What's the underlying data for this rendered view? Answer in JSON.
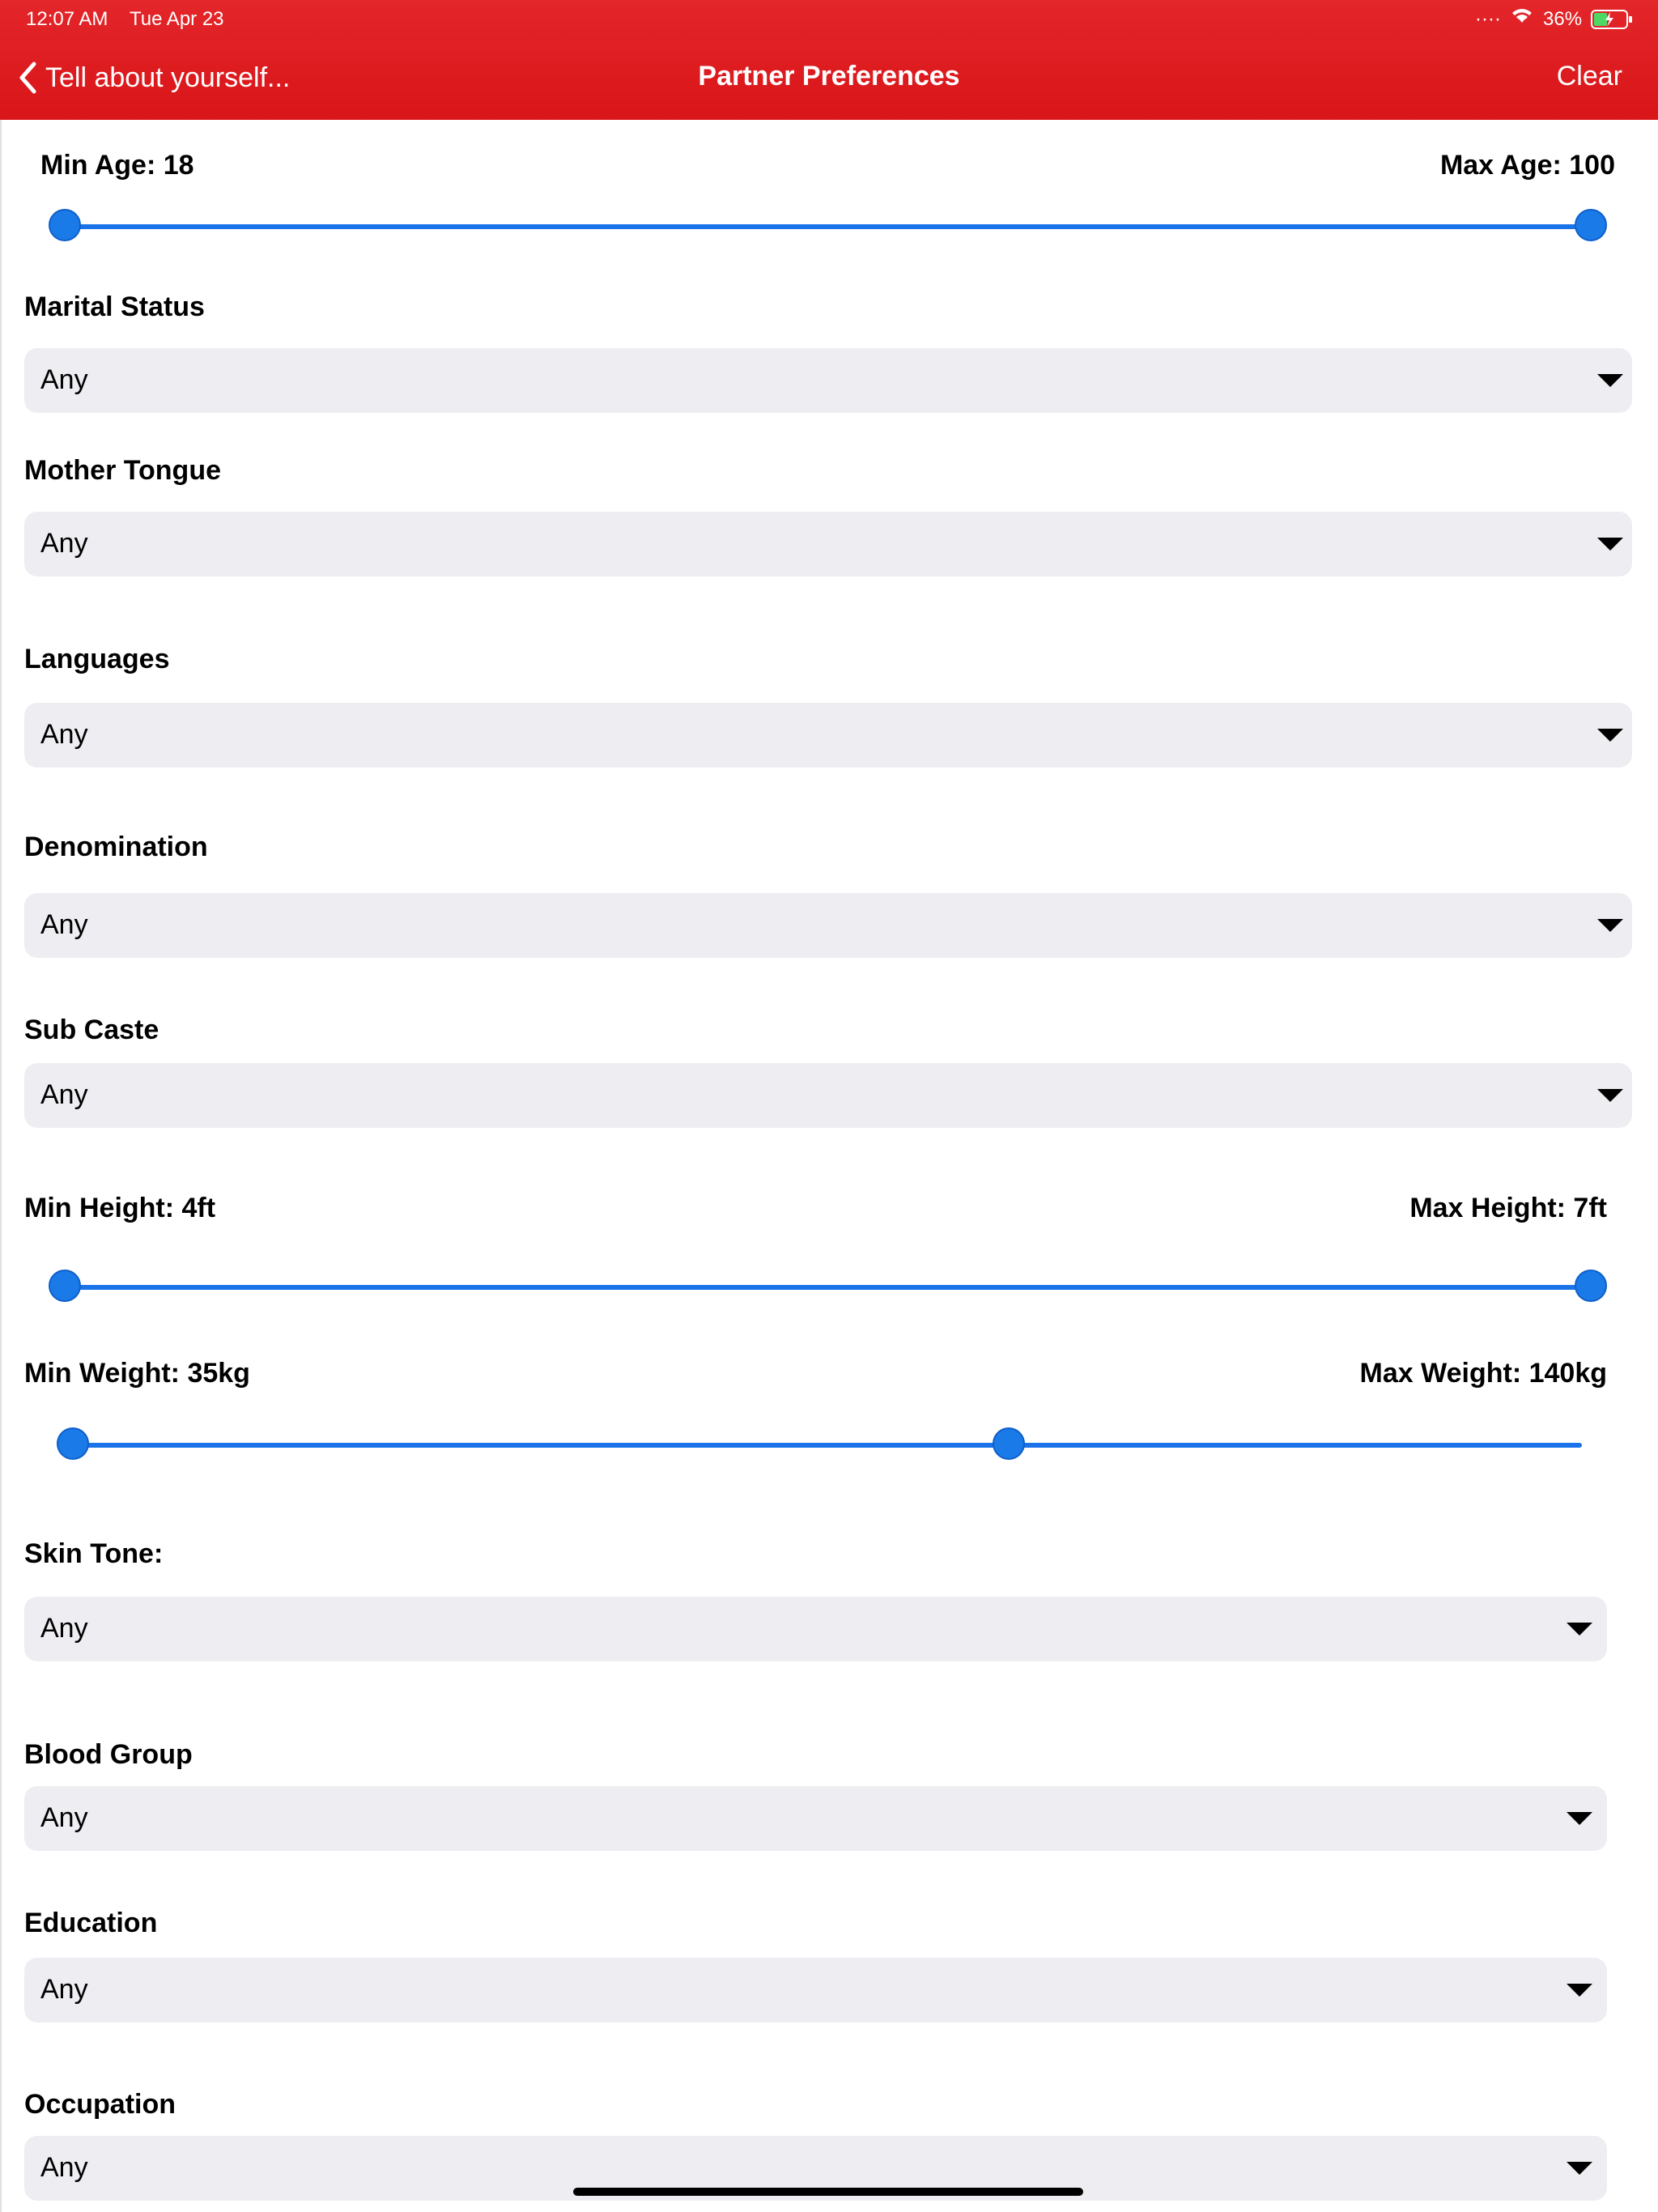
{
  "status_bar": {
    "time": "12:07 AM",
    "date": "Tue Apr 23",
    "battery": "36%"
  },
  "nav": {
    "back_label": "Tell about yourself...",
    "title": "Partner Preferences",
    "clear_label": "Clear"
  },
  "age": {
    "min_label": "Min Age: 18",
    "max_label": "Max Age: 100",
    "min": 18,
    "max": 100
  },
  "height": {
    "min_label": "Min Height: 4ft",
    "max_label": "Max Height: 7ft",
    "min": 4,
    "max": 7
  },
  "weight": {
    "min_label": "Min Weight: 35kg",
    "max_label": "Max Weight: 140kg",
    "min_fraction": 0.0,
    "max_fraction": 0.62
  },
  "fields": [
    {
      "label": "Marital Status",
      "value": "Any"
    },
    {
      "label": "Mother Tongue",
      "value": "Any"
    },
    {
      "label": "Languages",
      "value": "Any"
    },
    {
      "label": "Denomination",
      "value": "Any"
    },
    {
      "label": "Sub Caste",
      "value": "Any"
    },
    {
      "label": "Skin Tone:",
      "value": "Any"
    },
    {
      "label": "Blood Group",
      "value": "Any"
    },
    {
      "label": "Education",
      "value": "Any"
    },
    {
      "label": "Occupation",
      "value": "Any"
    }
  ],
  "colors": {
    "header": "#e3262a",
    "slider": "#1a73e8",
    "dropdown_bg": "#eeeef2"
  }
}
